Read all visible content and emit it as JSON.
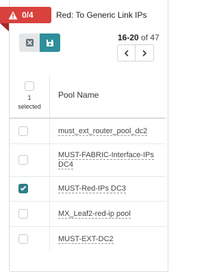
{
  "header": {
    "error_count": "0/4",
    "title": "Red: To Generic Link IPs",
    "badge_color": "#d9413d"
  },
  "toolbar": {
    "clear_icon": "close-square-icon",
    "save_icon": "floppy-disk-icon",
    "save_color": "#2e8f9a"
  },
  "pagination": {
    "range": "16-20",
    "of_label": "of",
    "total": "47"
  },
  "table": {
    "selected_count": "1",
    "selected_label": "selected",
    "column_header": "Pool Name",
    "rows": [
      {
        "name": "must_ext_router_pool_dc2",
        "checked": false
      },
      {
        "name": "MUST-FABRIC-Interface-IPs DC4",
        "checked": false
      },
      {
        "name": "MUST-Red-IPs DC3",
        "checked": true
      },
      {
        "name": "MX_Leaf2-red-ip pool",
        "checked": false
      },
      {
        "name": "MUST-EXT-DC2",
        "checked": false
      }
    ]
  }
}
